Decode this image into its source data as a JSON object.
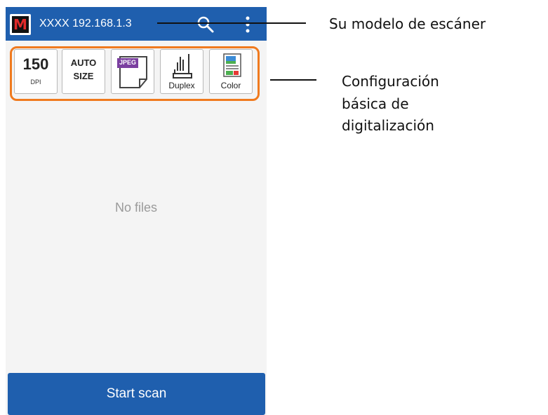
{
  "app_bar": {
    "logo_letter": "M",
    "model": "XXXX",
    "ip": "192.168.1.3",
    "title": "XXXX  192.168.1.3",
    "search_icon": "search-icon",
    "more_icon": "more-vert-icon",
    "color": "#1f5fae"
  },
  "settings": {
    "frame_color": "#f07a1e",
    "resolution": {
      "value": "150",
      "unit": "DPI"
    },
    "paper_size": {
      "line1": "AUTO",
      "line2": "SIZE"
    },
    "file_format": {
      "badge": "JPEG",
      "icon": "jpeg-file-icon"
    },
    "scan_side": {
      "label": "Duplex",
      "icon": "duplex-icon"
    },
    "color_mode": {
      "label": "Color",
      "icon": "color-image-icon"
    }
  },
  "main": {
    "empty_text": "No files"
  },
  "actions": {
    "start_scan_label": "Start scan"
  },
  "callouts": {
    "model": "Su modelo de escáner",
    "basic_settings_line1": "Configuración",
    "basic_settings_line2": "básica de",
    "basic_settings_line3": "digitalización"
  }
}
